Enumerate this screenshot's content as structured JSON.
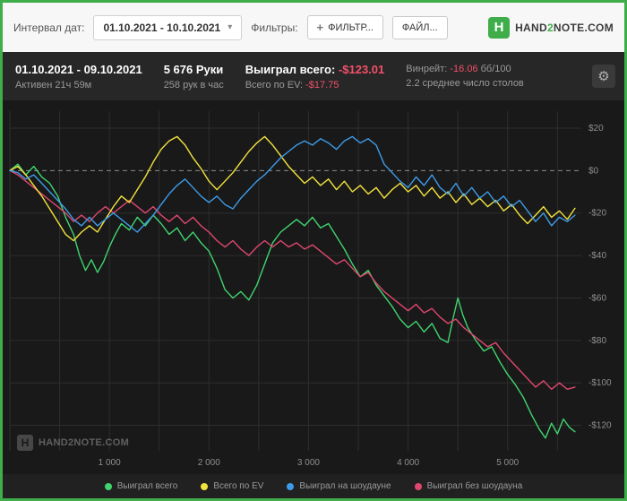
{
  "colors": {
    "accent": "#3fae4a",
    "negative": "#f4506a",
    "topbar_bg": "#f7f7f7",
    "stats_bg": "#272727",
    "chart_bg": "#191919",
    "legend_bg": "#212121"
  },
  "topbar": {
    "interval_label": "Интервал дат:",
    "date_value": "01.10.2021 - 10.10.2021",
    "filters_label": "Фильтры:",
    "filter_button": "ФИЛЬТР...",
    "file_button": "ФАЙЛ...",
    "logo": {
      "part1": "HAND",
      "part2": "2",
      "part3": "NOTE.COM"
    }
  },
  "icons": {
    "caret": "▾",
    "plus": "+",
    "gear": "⚙",
    "logo_h": "H"
  },
  "stats": {
    "date_range": "01.10.2021 - 09.10.2021",
    "active_time": "Активен 21ч 59м",
    "hands": "5 676 Руки",
    "hands_per_hour": "258 рук в час",
    "won_label": "Выиграл всего:",
    "won_value": "-$123.01",
    "ev_label": "Всего по EV:",
    "ev_value": "-$17.75",
    "winrate_label": "Винрейт:",
    "winrate_value": "-16.06",
    "winrate_suffix": "бб/100",
    "avg_tables": "2.2 среднее число столов"
  },
  "watermark": {
    "mark": "H",
    "text": "HAND2NOTE.COM"
  },
  "chart_data": {
    "type": "line",
    "title": "",
    "xlabel": "",
    "ylabel": "",
    "x_unit": "hands",
    "y_unit": "$",
    "xlim": [
      0,
      5740
    ],
    "ylim": [
      -132,
      28
    ],
    "grid": true,
    "x_grid_step": 500,
    "legend_position": "bottom",
    "grid_color": "#2e2e2e",
    "zero_line_color": "#8c8c8c",
    "axis_text_color": "#8f8f8f",
    "x_ticks": [
      {
        "v": 1000,
        "label": "1 000"
      },
      {
        "v": 2000,
        "label": "2 000"
      },
      {
        "v": 3000,
        "label": "3 000"
      },
      {
        "v": 4000,
        "label": "4 000"
      },
      {
        "v": 5000,
        "label": "5 000"
      }
    ],
    "y_ticks": [
      {
        "v": 20,
        "label": "$20"
      },
      {
        "v": 0,
        "label": "$0"
      },
      {
        "v": -20,
        "label": "-$20"
      },
      {
        "v": -40,
        "label": "-$40"
      },
      {
        "v": -60,
        "label": "-$60"
      },
      {
        "v": -80,
        "label": "-$80"
      },
      {
        "v": -100,
        "label": "-$100"
      },
      {
        "v": -120,
        "label": "-$120"
      }
    ],
    "series": [
      {
        "name": "Выиграл всего",
        "color": "#3fd56f",
        "final_value": -123.01,
        "points": [
          [
            0,
            0
          ],
          [
            80,
            3
          ],
          [
            160,
            -2
          ],
          [
            240,
            2
          ],
          [
            320,
            -3
          ],
          [
            400,
            -6
          ],
          [
            480,
            -12
          ],
          [
            560,
            -22
          ],
          [
            640,
            -30
          ],
          [
            700,
            -40
          ],
          [
            760,
            -47
          ],
          [
            820,
            -42
          ],
          [
            880,
            -48
          ],
          [
            940,
            -43
          ],
          [
            1000,
            -36
          ],
          [
            1060,
            -30
          ],
          [
            1120,
            -25
          ],
          [
            1200,
            -28
          ],
          [
            1280,
            -22
          ],
          [
            1360,
            -26
          ],
          [
            1440,
            -21
          ],
          [
            1520,
            -25
          ],
          [
            1600,
            -30
          ],
          [
            1680,
            -27
          ],
          [
            1760,
            -33
          ],
          [
            1840,
            -29
          ],
          [
            1920,
            -34
          ],
          [
            2000,
            -38
          ],
          [
            2080,
            -46
          ],
          [
            2160,
            -56
          ],
          [
            2240,
            -60
          ],
          [
            2320,
            -57
          ],
          [
            2400,
            -61
          ],
          [
            2480,
            -54
          ],
          [
            2560,
            -44
          ],
          [
            2640,
            -34
          ],
          [
            2720,
            -29
          ],
          [
            2800,
            -26
          ],
          [
            2880,
            -23
          ],
          [
            2960,
            -26
          ],
          [
            3040,
            -22
          ],
          [
            3120,
            -27
          ],
          [
            3200,
            -25
          ],
          [
            3280,
            -31
          ],
          [
            3360,
            -37
          ],
          [
            3440,
            -44
          ],
          [
            3520,
            -50
          ],
          [
            3600,
            -47
          ],
          [
            3680,
            -54
          ],
          [
            3760,
            -59
          ],
          [
            3840,
            -64
          ],
          [
            3920,
            -70
          ],
          [
            4000,
            -74
          ],
          [
            4080,
            -71
          ],
          [
            4160,
            -76
          ],
          [
            4240,
            -72
          ],
          [
            4320,
            -79
          ],
          [
            4400,
            -81
          ],
          [
            4450,
            -70
          ],
          [
            4500,
            -60
          ],
          [
            4550,
            -68
          ],
          [
            4600,
            -74
          ],
          [
            4680,
            -80
          ],
          [
            4760,
            -85
          ],
          [
            4840,
            -83
          ],
          [
            4920,
            -90
          ],
          [
            5000,
            -96
          ],
          [
            5080,
            -101
          ],
          [
            5160,
            -107
          ],
          [
            5240,
            -115
          ],
          [
            5320,
            -122
          ],
          [
            5380,
            -126
          ],
          [
            5440,
            -119
          ],
          [
            5500,
            -124
          ],
          [
            5560,
            -117
          ],
          [
            5620,
            -121
          ],
          [
            5676,
            -123
          ]
        ]
      },
      {
        "name": "Всего по EV",
        "color": "#f2e33c",
        "final_value": -17.75,
        "points": [
          [
            0,
            0
          ],
          [
            80,
            2
          ],
          [
            160,
            -2
          ],
          [
            240,
            -7
          ],
          [
            320,
            -12
          ],
          [
            400,
            -18
          ],
          [
            480,
            -24
          ],
          [
            560,
            -30
          ],
          [
            640,
            -33
          ],
          [
            720,
            -29
          ],
          [
            800,
            -26
          ],
          [
            880,
            -29
          ],
          [
            960,
            -23
          ],
          [
            1040,
            -17
          ],
          [
            1120,
            -12
          ],
          [
            1200,
            -15
          ],
          [
            1280,
            -9
          ],
          [
            1360,
            -3
          ],
          [
            1440,
            4
          ],
          [
            1520,
            10
          ],
          [
            1600,
            14
          ],
          [
            1680,
            16
          ],
          [
            1760,
            12
          ],
          [
            1840,
            6
          ],
          [
            1920,
            1
          ],
          [
            2000,
            -5
          ],
          [
            2080,
            -9
          ],
          [
            2160,
            -5
          ],
          [
            2240,
            -1
          ],
          [
            2320,
            4
          ],
          [
            2400,
            9
          ],
          [
            2480,
            13
          ],
          [
            2560,
            16
          ],
          [
            2640,
            12
          ],
          [
            2720,
            7
          ],
          [
            2800,
            2
          ],
          [
            2880,
            -2
          ],
          [
            2960,
            -6
          ],
          [
            3040,
            -3
          ],
          [
            3120,
            -7
          ],
          [
            3200,
            -4
          ],
          [
            3280,
            -9
          ],
          [
            3360,
            -5
          ],
          [
            3440,
            -10
          ],
          [
            3520,
            -7
          ],
          [
            3600,
            -11
          ],
          [
            3680,
            -8
          ],
          [
            3760,
            -13
          ],
          [
            3840,
            -9
          ],
          [
            3920,
            -6
          ],
          [
            4000,
            -10
          ],
          [
            4080,
            -7
          ],
          [
            4160,
            -12
          ],
          [
            4240,
            -8
          ],
          [
            4320,
            -13
          ],
          [
            4400,
            -10
          ],
          [
            4480,
            -15
          ],
          [
            4560,
            -11
          ],
          [
            4640,
            -16
          ],
          [
            4720,
            -13
          ],
          [
            4800,
            -17
          ],
          [
            4880,
            -14
          ],
          [
            4960,
            -19
          ],
          [
            5040,
            -16
          ],
          [
            5120,
            -21
          ],
          [
            5200,
            -25
          ],
          [
            5280,
            -21
          ],
          [
            5360,
            -17
          ],
          [
            5440,
            -22
          ],
          [
            5520,
            -19
          ],
          [
            5600,
            -23
          ],
          [
            5676,
            -17.75
          ]
        ]
      },
      {
        "name": "Выиграл на шоудауне",
        "color": "#3d9be9",
        "points": [
          [
            0,
            0
          ],
          [
            80,
            -1
          ],
          [
            160,
            -4
          ],
          [
            240,
            -2
          ],
          [
            320,
            -6
          ],
          [
            400,
            -10
          ],
          [
            480,
            -14
          ],
          [
            560,
            -18
          ],
          [
            640,
            -23
          ],
          [
            720,
            -26
          ],
          [
            800,
            -22
          ],
          [
            880,
            -26
          ],
          [
            960,
            -23
          ],
          [
            1040,
            -20
          ],
          [
            1120,
            -23
          ],
          [
            1200,
            -26
          ],
          [
            1280,
            -29
          ],
          [
            1360,
            -25
          ],
          [
            1440,
            -21
          ],
          [
            1520,
            -16
          ],
          [
            1600,
            -11
          ],
          [
            1680,
            -7
          ],
          [
            1760,
            -4
          ],
          [
            1840,
            -8
          ],
          [
            1920,
            -12
          ],
          [
            2000,
            -15
          ],
          [
            2080,
            -12
          ],
          [
            2160,
            -16
          ],
          [
            2240,
            -18
          ],
          [
            2320,
            -13
          ],
          [
            2400,
            -9
          ],
          [
            2480,
            -5
          ],
          [
            2560,
            -2
          ],
          [
            2640,
            2
          ],
          [
            2720,
            6
          ],
          [
            2800,
            9
          ],
          [
            2880,
            12
          ],
          [
            2960,
            14
          ],
          [
            3040,
            12
          ],
          [
            3120,
            15
          ],
          [
            3200,
            13
          ],
          [
            3280,
            10
          ],
          [
            3360,
            14
          ],
          [
            3440,
            16
          ],
          [
            3520,
            13
          ],
          [
            3600,
            15
          ],
          [
            3680,
            12
          ],
          [
            3760,
            3
          ],
          [
            3840,
            -1
          ],
          [
            3920,
            -5
          ],
          [
            4000,
            -8
          ],
          [
            4080,
            -3
          ],
          [
            4160,
            -7
          ],
          [
            4240,
            -2
          ],
          [
            4320,
            -8
          ],
          [
            4400,
            -11
          ],
          [
            4480,
            -6
          ],
          [
            4560,
            -12
          ],
          [
            4640,
            -8
          ],
          [
            4720,
            -13
          ],
          [
            4800,
            -10
          ],
          [
            4880,
            -15
          ],
          [
            4960,
            -12
          ],
          [
            5040,
            -17
          ],
          [
            5120,
            -14
          ],
          [
            5200,
            -19
          ],
          [
            5280,
            -24
          ],
          [
            5360,
            -20
          ],
          [
            5440,
            -26
          ],
          [
            5520,
            -22
          ],
          [
            5600,
            -24
          ],
          [
            5676,
            -21
          ]
        ]
      },
      {
        "name": "Выиграл без шоудауна",
        "color": "#e0476f",
        "points": [
          [
            0,
            0
          ],
          [
            80,
            -2
          ],
          [
            160,
            -5
          ],
          [
            240,
            -8
          ],
          [
            320,
            -11
          ],
          [
            400,
            -14
          ],
          [
            480,
            -17
          ],
          [
            560,
            -20
          ],
          [
            640,
            -24
          ],
          [
            720,
            -21
          ],
          [
            800,
            -24
          ],
          [
            880,
            -20
          ],
          [
            960,
            -17
          ],
          [
            1040,
            -20
          ],
          [
            1120,
            -17
          ],
          [
            1200,
            -14
          ],
          [
            1280,
            -17
          ],
          [
            1360,
            -20
          ],
          [
            1440,
            -17
          ],
          [
            1520,
            -21
          ],
          [
            1600,
            -24
          ],
          [
            1680,
            -21
          ],
          [
            1760,
            -25
          ],
          [
            1840,
            -22
          ],
          [
            1920,
            -26
          ],
          [
            2000,
            -29
          ],
          [
            2080,
            -33
          ],
          [
            2160,
            -36
          ],
          [
            2240,
            -33
          ],
          [
            2320,
            -37
          ],
          [
            2400,
            -40
          ],
          [
            2480,
            -36
          ],
          [
            2560,
            -33
          ],
          [
            2640,
            -36
          ],
          [
            2720,
            -33
          ],
          [
            2800,
            -36
          ],
          [
            2880,
            -34
          ],
          [
            2960,
            -37
          ],
          [
            3040,
            -35
          ],
          [
            3120,
            -38
          ],
          [
            3200,
            -41
          ],
          [
            3280,
            -44
          ],
          [
            3360,
            -42
          ],
          [
            3440,
            -46
          ],
          [
            3520,
            -50
          ],
          [
            3600,
            -48
          ],
          [
            3680,
            -53
          ],
          [
            3760,
            -57
          ],
          [
            3840,
            -60
          ],
          [
            3920,
            -63
          ],
          [
            4000,
            -66
          ],
          [
            4080,
            -63
          ],
          [
            4160,
            -67
          ],
          [
            4240,
            -65
          ],
          [
            4320,
            -69
          ],
          [
            4400,
            -72
          ],
          [
            4480,
            -70
          ],
          [
            4560,
            -74
          ],
          [
            4640,
            -77
          ],
          [
            4720,
            -80
          ],
          [
            4800,
            -83
          ],
          [
            4880,
            -81
          ],
          [
            4960,
            -86
          ],
          [
            5040,
            -90
          ],
          [
            5120,
            -94
          ],
          [
            5200,
            -98
          ],
          [
            5280,
            -102
          ],
          [
            5360,
            -99
          ],
          [
            5440,
            -103
          ],
          [
            5520,
            -100
          ],
          [
            5600,
            -103
          ],
          [
            5676,
            -102
          ]
        ]
      }
    ]
  }
}
